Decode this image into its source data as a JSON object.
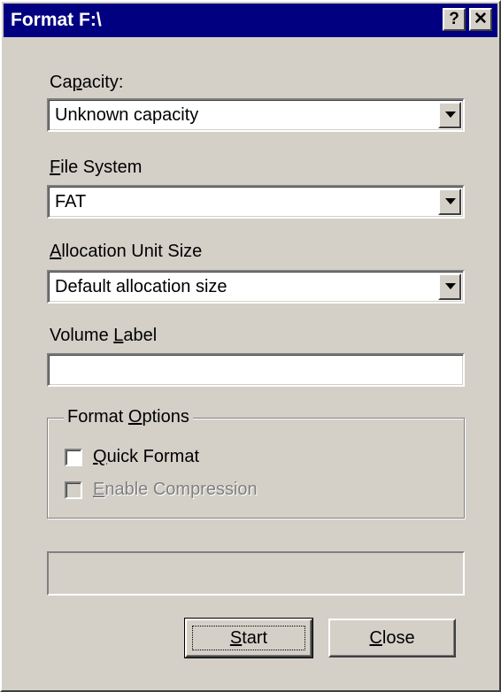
{
  "window": {
    "title": "Format F:\\",
    "help_button": "?",
    "close_button": "✕"
  },
  "capacity": {
    "label_pre": "Ca",
    "label_key": "p",
    "label_post": "acity:",
    "value": "Unknown capacity"
  },
  "file_system": {
    "label_key": "F",
    "label_post": "ile System",
    "value": "FAT"
  },
  "allocation": {
    "label_key": "A",
    "label_post": "llocation Unit Size",
    "value": "Default allocation size"
  },
  "volume_label": {
    "label_pre": "Volume ",
    "label_key": "L",
    "label_post": "abel",
    "value": ""
  },
  "format_options": {
    "title_pre": "Format ",
    "title_key": "O",
    "title_post": "ptions",
    "quick_format": {
      "label_key": "Q",
      "label_post": "uick Format",
      "checked": false
    },
    "enable_compression": {
      "label_key": "E",
      "label_post": "nable Compression",
      "checked": false,
      "disabled": true
    }
  },
  "progress": {
    "value": 0
  },
  "buttons": {
    "start_key": "S",
    "start_post": "tart",
    "close_key": "C",
    "close_post": "lose"
  }
}
